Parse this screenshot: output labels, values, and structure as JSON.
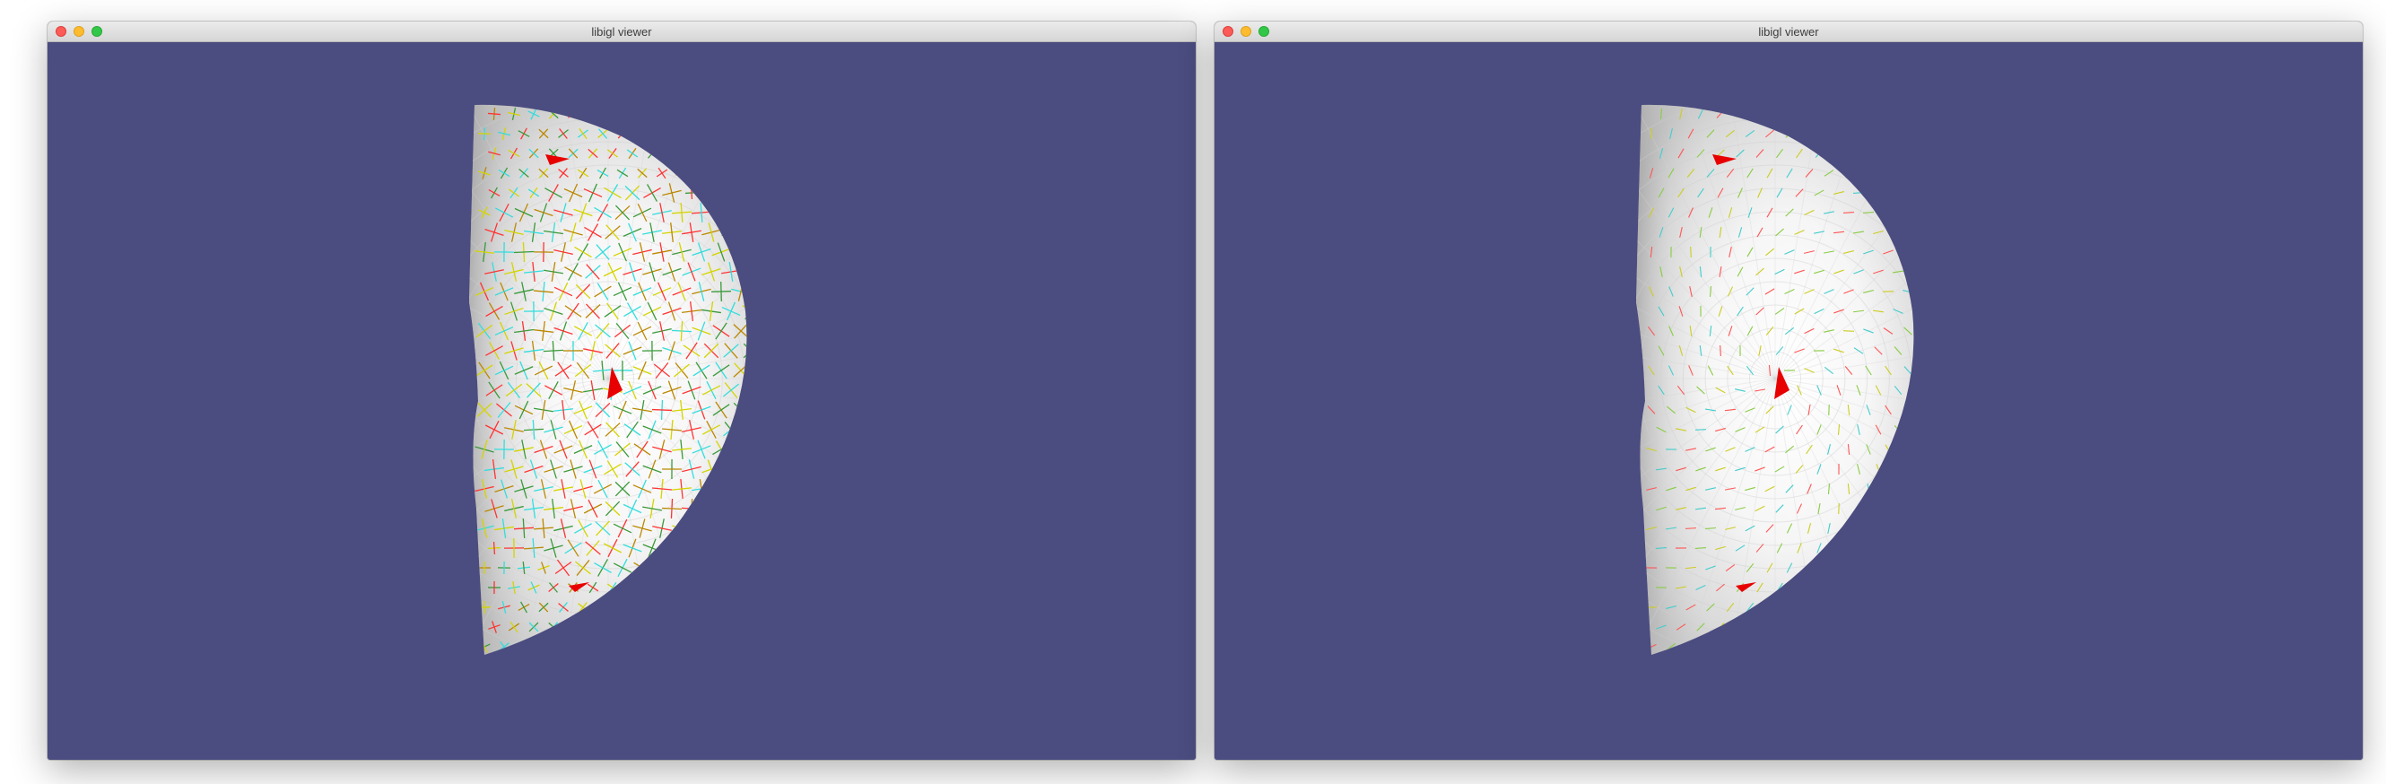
{
  "windows": [
    {
      "title": "libigl viewer",
      "background_color": "#4b4c7f",
      "mesh_color": "#ffffff",
      "field_style": "cross",
      "field_colors": [
        "#d4d400",
        "#3a9a3a",
        "#ff3333",
        "#33dddd",
        "#bb8800"
      ],
      "constraint_color": "#ff0000"
    },
    {
      "title": "libigl viewer",
      "background_color": "#4b4c7f",
      "mesh_color": "#ffffff",
      "field_style": "ticks",
      "field_colors": [
        "#cccc22",
        "#88cc44",
        "#ff5555",
        "#44cccc"
      ],
      "constraint_color": "#ff0000"
    }
  ]
}
